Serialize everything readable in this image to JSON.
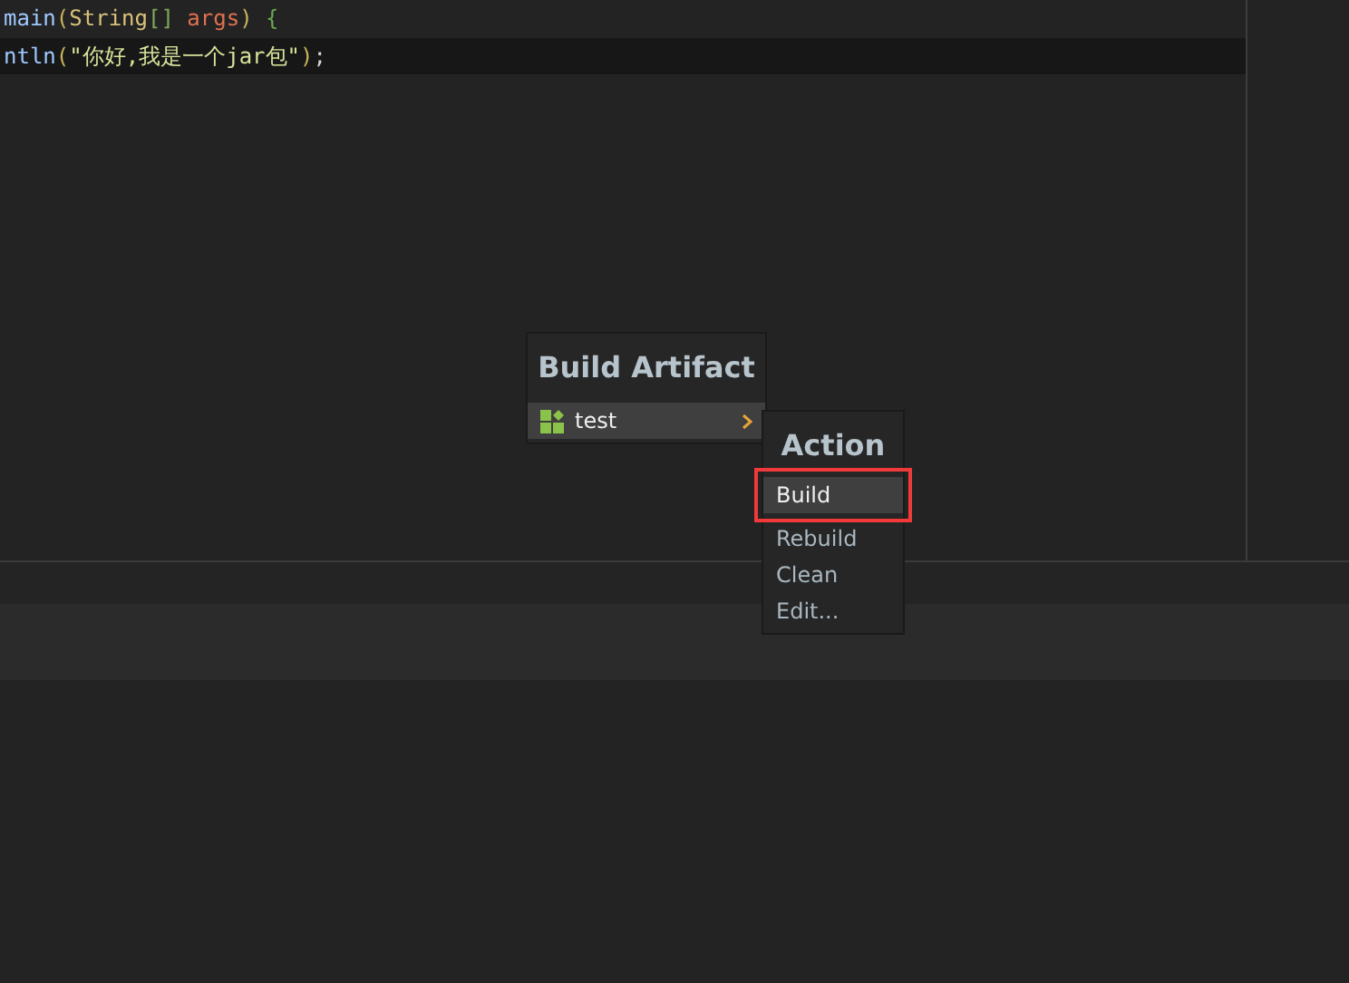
{
  "code_lines": [
    {
      "highlighted": false,
      "tokens": [
        {
          "text": "main",
          "kind": "ident"
        },
        {
          "text": "(",
          "kind": "paren"
        },
        {
          "text": "String",
          "kind": "type"
        },
        {
          "text": "[]",
          "kind": "bracket"
        },
        {
          "text": " args",
          "kind": "param"
        },
        {
          "text": ")",
          "kind": "paren"
        },
        {
          "text": " {",
          "kind": "brace"
        }
      ]
    },
    {
      "highlighted": true,
      "tokens": [
        {
          "text": "ntln",
          "kind": "ident"
        },
        {
          "text": "(",
          "kind": "paren"
        },
        {
          "text": "\"你好,我是一个jar包\"",
          "kind": "string"
        },
        {
          "text": ")",
          "kind": "paren"
        },
        {
          "text": ";",
          "kind": "plain"
        }
      ]
    }
  ],
  "build_popup": {
    "title": "Build Artifact",
    "items": [
      {
        "label": "test",
        "selected": true,
        "has_submenu": true
      }
    ]
  },
  "action_popup": {
    "title": "Action",
    "items": [
      {
        "label": "Build",
        "selected": true,
        "outlined": true
      },
      {
        "label": "Rebuild",
        "selected": false,
        "outlined": false
      },
      {
        "label": "Clean",
        "selected": false,
        "outlined": false
      },
      {
        "label": "Edit...",
        "selected": false,
        "outlined": false
      }
    ]
  }
}
